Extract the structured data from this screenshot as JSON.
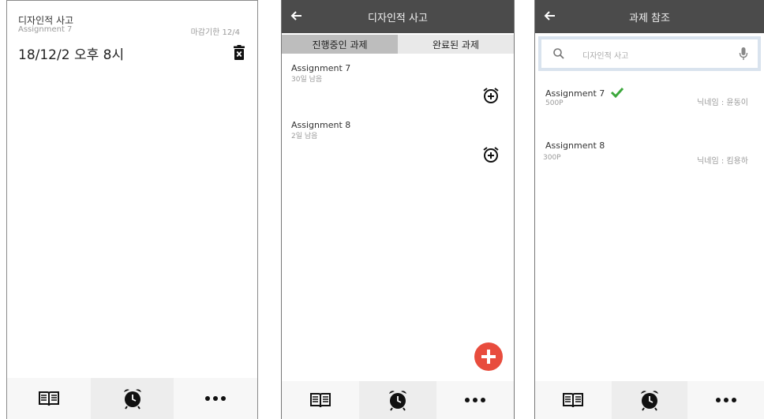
{
  "screen1": {
    "course": "디자인적 사고",
    "assignment": "Assignment 7",
    "deadline": "마감기한 12/4",
    "alarm_time": "18/12/2 오후 8시",
    "delete_icon": "trash-x-icon",
    "nav": [
      "book-icon",
      "alarm-clock-icon",
      "more-dots-icon"
    ]
  },
  "screen2": {
    "title": "디자인적 사고",
    "tabs": [
      "진행중인 과제",
      "완료된 과제"
    ],
    "items": [
      {
        "title": "Assignment 7",
        "sub": "30일 남음"
      },
      {
        "title": "Assignment 8",
        "sub": "2일 남음"
      }
    ],
    "fab_color": "#e84c3d",
    "nav": [
      "book-icon",
      "alarm-clock-icon",
      "more-dots-icon"
    ]
  },
  "screen3": {
    "title": "과제 참조",
    "search_placeholder": "디자인적 사고",
    "items": [
      {
        "title": "Assignment 7",
        "points": "500P",
        "nickname": "닉네임 : 윤동이",
        "completed": true
      },
      {
        "title": "Assignment 8",
        "points": "300P",
        "nickname": "닉네임 : 킴용하",
        "completed": false
      }
    ],
    "check_color": "#3ca83c",
    "nav": [
      "book-icon",
      "alarm-clock-icon",
      "more-dots-icon"
    ]
  }
}
